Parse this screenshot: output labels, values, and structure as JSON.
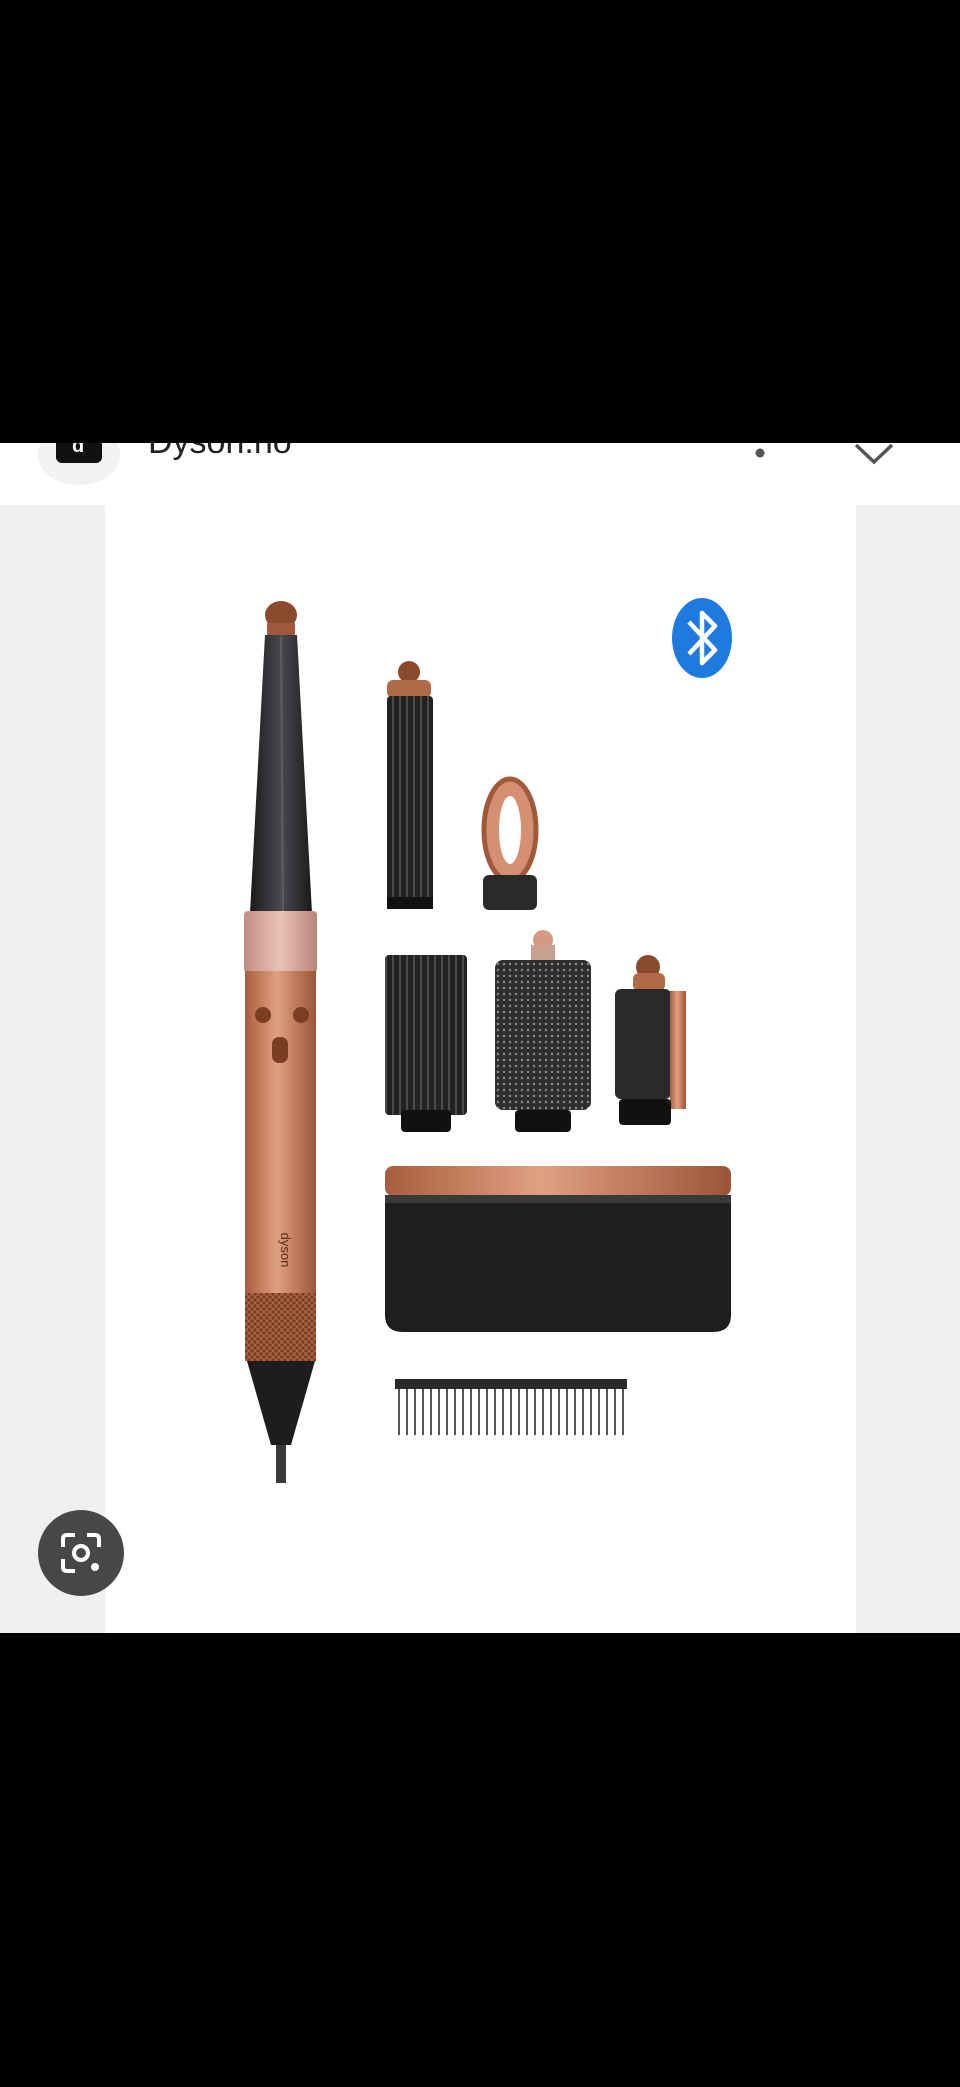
{
  "header": {
    "site_name": "Dyson.no",
    "site_icon_glyph": "d",
    "more_icon": "more-vert-icon",
    "close_icon": "close-icon"
  },
  "image": {
    "brand_text": "dyson",
    "bluetooth_icon": "bluetooth-icon"
  },
  "lens": {
    "icon": "lens-icon"
  },
  "colors": {
    "copper": "#c27a5a",
    "copper_dark": "#8a4a2c",
    "rose_band": "#d9a89b",
    "charcoal": "#2a2a2c",
    "bluetooth_blue": "#1f7ae0",
    "viewer_bg": "#eef0f1",
    "lens_bg": "#474747"
  }
}
